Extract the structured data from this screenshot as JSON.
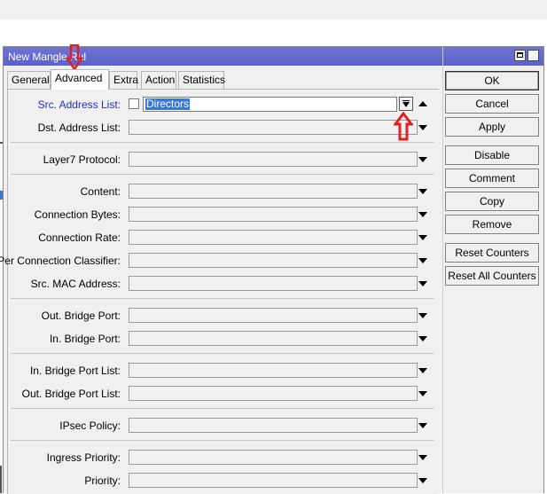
{
  "window": {
    "title": "New Mangle Rul",
    "close_label": "✕"
  },
  "tabs": [
    {
      "label": "General",
      "active": false
    },
    {
      "label": "Advanced",
      "active": true
    },
    {
      "label": "Extra",
      "active": false
    },
    {
      "label": "Action",
      "active": false
    },
    {
      "label": "Statistics",
      "active": false
    }
  ],
  "fields": {
    "src_address_list": {
      "label": "Src. Address List:",
      "value": "Directors",
      "negate_checked": false
    },
    "dst_address_list": {
      "label": "Dst. Address List:",
      "value": ""
    },
    "layer7_protocol": {
      "label": "Layer7 Protocol:",
      "value": ""
    },
    "content": {
      "label": "Content:",
      "value": ""
    },
    "connection_bytes": {
      "label": "Connection Bytes:",
      "value": ""
    },
    "connection_rate": {
      "label": "Connection Rate:",
      "value": ""
    },
    "per_connection_classifier": {
      "label": "Per Connection Classifier:",
      "value": ""
    },
    "src_mac_address": {
      "label": "Src. MAC Address:",
      "value": ""
    },
    "out_bridge_port": {
      "label": "Out. Bridge Port:",
      "value": ""
    },
    "in_bridge_port": {
      "label": "In. Bridge Port:",
      "value": ""
    },
    "in_bridge_port_list": {
      "label": "In. Bridge Port List:",
      "value": ""
    },
    "out_bridge_port_list": {
      "label": "Out. Bridge Port List:",
      "value": ""
    },
    "ipsec_policy": {
      "label": "IPsec Policy:",
      "value": ""
    },
    "ingress_priority": {
      "label": "Ingress Priority:",
      "value": ""
    },
    "priority": {
      "label": "Priority:",
      "value": ""
    }
  },
  "buttons": {
    "ok": "OK",
    "cancel": "Cancel",
    "apply": "Apply",
    "disable": "Disable",
    "comment": "Comment",
    "copy": "Copy",
    "remove": "Remove",
    "reset_counters": "Reset Counters",
    "reset_all_counters": "Reset All Counters"
  },
  "colors": {
    "titlebar": "#5c62c7",
    "highlighted_label": "#1f2fc8",
    "selection": "#3a78d8",
    "annotation_arrow": "#e0201e"
  },
  "annotations": [
    {
      "name": "red-down-arrow-icon",
      "points_to": "tab-advanced"
    },
    {
      "name": "red-up-arrow-icon",
      "points_to": "src-address-list-dropdown"
    }
  ]
}
